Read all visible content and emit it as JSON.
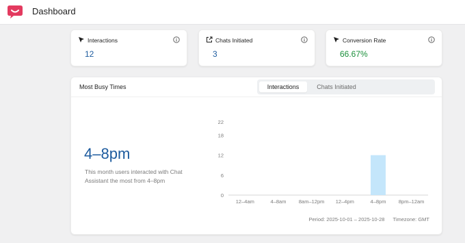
{
  "header": {
    "title": "Dashboard",
    "logo_color": "#e33a5f"
  },
  "stats": [
    {
      "label": "Interactions",
      "value": "12",
      "icon": "cursor-arrow-icon",
      "value_color": "#1d5b9e"
    },
    {
      "label": "Chats Initiated",
      "value": "3",
      "icon": "external-link-icon",
      "value_color": "#1d5b9e"
    },
    {
      "label": "Conversion Rate",
      "value": "66.67%",
      "icon": "cursor-arrow-icon",
      "value_color": "#1a8f3a"
    }
  ],
  "busy": {
    "title": "Most Busy Times",
    "tabs": [
      {
        "label": "Interactions",
        "active": true
      },
      {
        "label": "Chats Initiated",
        "active": false
      }
    ],
    "peak": "4–8pm",
    "description": "This month users interacted with Chat Assistant the most from 4–8pm",
    "period": "Period: 2025-10-01 – 2025-10-28",
    "timezone": "Timezone: GMT"
  },
  "chart_data": {
    "type": "bar",
    "categories": [
      "12–4am",
      "4–8am",
      "8am–12pm",
      "12–4pm",
      "4–8pm",
      "8pm–12am"
    ],
    "values": [
      0,
      0,
      0,
      0,
      12,
      0
    ],
    "yticks": [
      0,
      6,
      12,
      18,
      22
    ],
    "ylim": [
      0,
      22
    ],
    "bar_color": "#c4e6fb",
    "grid": false
  }
}
